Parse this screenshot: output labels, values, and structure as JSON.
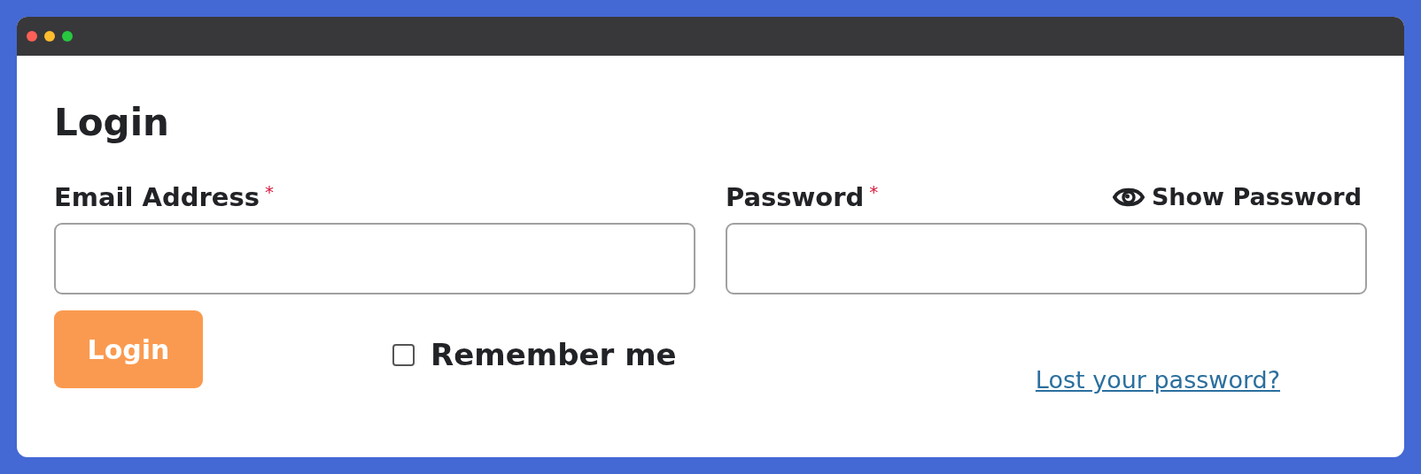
{
  "window": {
    "controls": [
      {
        "color": "#fe5f57"
      },
      {
        "color": "#febc2e"
      },
      {
        "color": "#28c840"
      }
    ]
  },
  "form": {
    "title": "Login",
    "fields": [
      {
        "label": "Email Address",
        "required_mark": "*"
      },
      {
        "label": "Password",
        "required_mark": "*",
        "toggle": "Show Password"
      }
    ],
    "submit": "Login",
    "remember": {
      "label": "Remember me",
      "checked": false
    },
    "lost_password": "Lost your password?"
  }
}
